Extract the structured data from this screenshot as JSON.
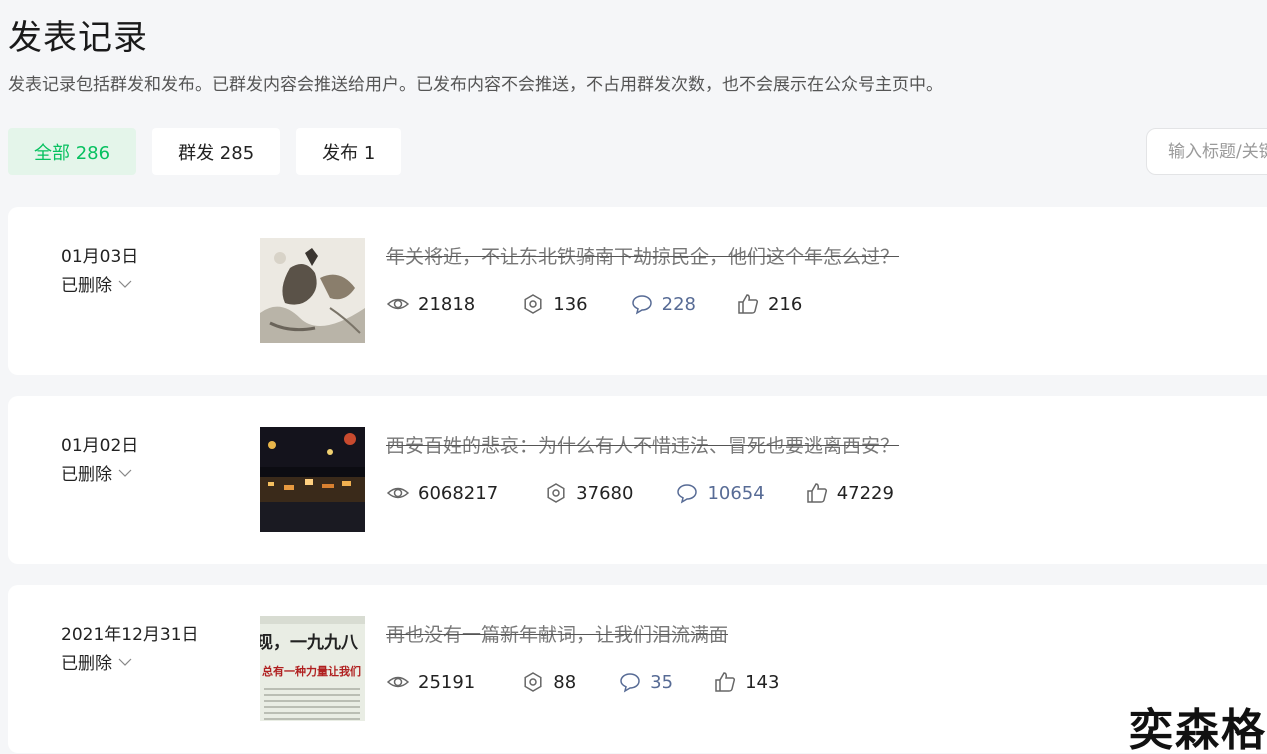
{
  "header": {
    "title": "发表记录",
    "description": "发表记录包括群发和发布。已群发内容会推送给用户。已发布内容不会推送，不占用群发次数，也不会展示在公众号主页中。"
  },
  "tabs": [
    {
      "label": "全部 286",
      "active": true
    },
    {
      "label": "群发 285",
      "active": false
    },
    {
      "label": "发布 1",
      "active": false
    }
  ],
  "search": {
    "placeholder": "输入标题/关键词"
  },
  "colors": {
    "accent": "#07c160",
    "comment": "#576b95"
  },
  "records": [
    {
      "date": "01月03日",
      "status": "已删除",
      "title": "年关将近，不让东北铁骑南下劫掠民企，他们这个年怎么过？",
      "thumb_icon": "ink-painting-horseman-thumbnail",
      "views": "21818",
      "shares": "136",
      "comments": "228",
      "likes": "216"
    },
    {
      "date": "01月02日",
      "status": "已删除",
      "title": "西安百姓的悲哀：为什么有人不惜违法、冒死也要逃离西安？",
      "thumb_icon": "night-city-thumbnail",
      "views": "6068217",
      "shares": "37680",
      "comments": "10654",
      "likes": "47229"
    },
    {
      "date": "2021年12月31日",
      "status": "已删除",
      "title": "再也没有一篇新年献词，让我们泪流满面",
      "thumb_icon": "newspaper-thumbnail",
      "thumb_text_1": "现，一九九八",
      "thumb_text_2": "总有一种力量让我们",
      "views": "25191",
      "shares": "88",
      "comments": "35",
      "likes": "143"
    }
  ],
  "watermark": "奕森格"
}
